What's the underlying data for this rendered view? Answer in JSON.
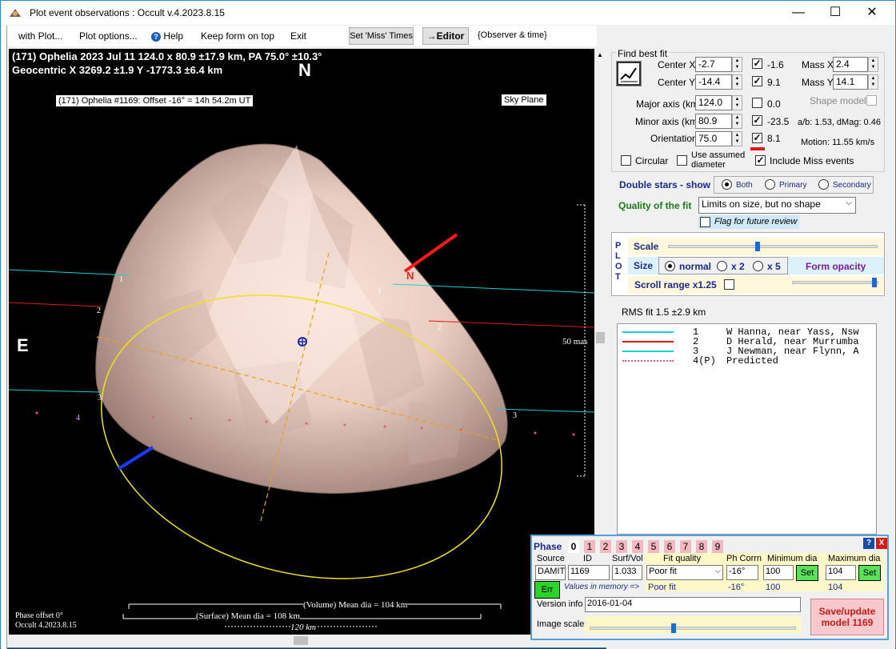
{
  "window": {
    "title": "Plot event observations : Occult v.4.2023.8.15",
    "minimize": "—",
    "maximize": "☐",
    "close": "✕"
  },
  "menu": {
    "with_plot": "with Plot...",
    "plot_options": "Plot options...",
    "help": "Help",
    "keep_on_top": "Keep form on top",
    "exit": "Exit",
    "set_miss": "Set 'Miss' Times",
    "editor": "→Editor",
    "observer_time": "{Observer & time}"
  },
  "plot": {
    "header1": "(171) Ophelia  2023 Jul 11  124.0 x 80.9 ±17.9 km, PA 75.0° ±10.3°",
    "header2": "Geocentric  X  3269.2 ±1.9  Y -1773.3 ±6.4 km",
    "north": "N",
    "east": "E",
    "north_arrow": "N",
    "model_label": "(171) Ophelia #1169: Offset -16° = 14h 54.2m UT",
    "sky_plane": "Sky Plane",
    "scale_mas": "50 mas",
    "phase_offset": "Phase offset 0°",
    "occult_version": "Occult 4.2023.8.15",
    "volume_dia": "(Volume) Mean dia = 104 km",
    "surface_dia": "(Surface) Mean dia = 108 km",
    "scale_km": "120 km",
    "chord_labels": [
      "1",
      "1",
      "2",
      "2",
      "3",
      "3",
      "4"
    ]
  },
  "fit": {
    "title": "Find best fit",
    "center_x_label": "Center X",
    "center_x": "-2.7",
    "center_x_chk": "-1.6",
    "center_y_label": "Center Y",
    "center_y": "-14.4",
    "center_y_chk": "9.1",
    "major_label": "Major axis (km)",
    "major": "124.0",
    "major_chk": "0.0",
    "minor_label": "Minor axis (km)",
    "minor": "80.9",
    "minor_chk": "-23.5",
    "orient_label": "Orientation",
    "orient": "75.0",
    "orient_chk": "8.1",
    "mass_x_label": "Mass X",
    "mass_x": "2.4",
    "mass_y_label": "Mass Y",
    "mass_y": "14.1",
    "shape_model": "Shape model",
    "ab": "a/b: 1.53, dMag: 0.46",
    "motion": "Motion: 11.55 km/s",
    "circular": "Circular",
    "use_assumed": "Use assumed diameter",
    "include_miss": "Include Miss events",
    "double_stars": "Double stars - show",
    "both": "Both",
    "primary": "Primary",
    "secondary": "Secondary",
    "quality_label": "Quality of the fit",
    "quality_value": "Limits on size, but no shape",
    "flag_review": "Flag for future review"
  },
  "plotctl": {
    "plot_vert": "P\nL\nO\nT",
    "scale": "Scale",
    "size": "Size",
    "normal": "normal",
    "x2": "x 2",
    "x5": "x 5",
    "form_opacity": "Form opacity",
    "scroll_range": "Scroll range x1.25",
    "scale_level": 0.42,
    "opacity_level": 0.97
  },
  "rms": "RMS fit  1.5 ±2.9 km",
  "legend": [
    {
      "n": "1",
      "text": "W Hanna, near Yass, Nsw",
      "color": "#19d2d2",
      "style": "solid"
    },
    {
      "n": "2",
      "text": "D Herald, near Murrumba",
      "color": "#e01818",
      "style": "solid"
    },
    {
      "n": "3",
      "text": "J Newman, near Flynn, A",
      "color": "#19d2d2",
      "style": "solid"
    },
    {
      "n": "4(P)",
      "text": "Predicted",
      "color": "#e8587e",
      "style": "dotted"
    }
  ],
  "phase": {
    "title": "Phase",
    "numbers": [
      "0",
      "1",
      "2",
      "3",
      "4",
      "5",
      "6",
      "7",
      "8",
      "9"
    ],
    "source_h": "Source",
    "id_h": "ID",
    "surf_h": "Surf/Vol",
    "fitq_h": "Fit quality",
    "phcorr_h": "Ph Corrn",
    "mindia_h": "Minimum dia",
    "maxdia_h": "Maximum dia",
    "source": "DAMIT",
    "id": "1169",
    "surf": "1.033",
    "fitq": "Poor fit",
    "phcorr": "-16°",
    "mindia": "100",
    "maxdia": "104",
    "set": "Set",
    "err": "Err",
    "values_memory": "Values in memory =>",
    "mem_fitq": "Poor fit",
    "mem_phcorr": "-16°",
    "mem_min": "100",
    "mem_max": "104",
    "version_label": "Version info",
    "version": "2016-01-04",
    "image_scale": "Image scale",
    "image_scale_level": 0.4,
    "save": "Save/update model 1169",
    "help": "?",
    "close": "X"
  }
}
